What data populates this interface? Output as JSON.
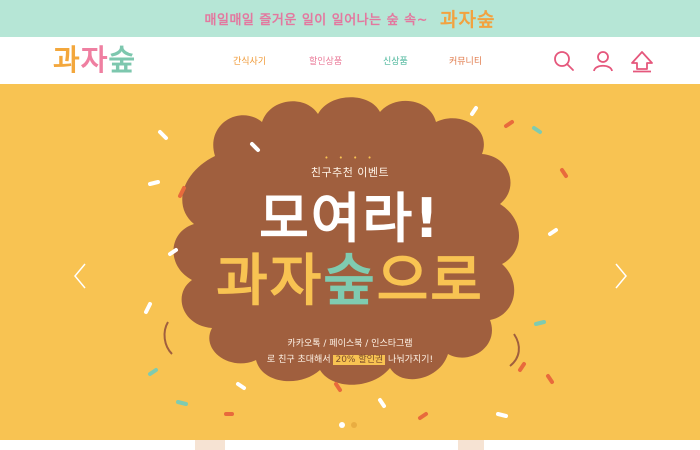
{
  "promo": {
    "text": "매일매일 즐거운 일이 일어나는 숲 속~",
    "logo": "과자숲"
  },
  "header": {
    "logo": {
      "part1": "과",
      "part2": "자",
      "part3": "숲"
    },
    "nav": [
      {
        "label": "간식사기"
      },
      {
        "label": "할인상품"
      },
      {
        "label": "신상품"
      },
      {
        "label": "커뮤니티"
      }
    ],
    "icons": [
      "search-icon",
      "user-icon",
      "home-icon"
    ]
  },
  "hero": {
    "eyebrow": "친구추천 이벤트",
    "headline1": "모여라!",
    "headline2_part1": "과자",
    "headline2_accent": "숲",
    "headline2_part2": "으로",
    "sub_line1": "카카오톡 / 페이스북 / 인스타그램",
    "sub_line2_pre": "로 친구 초대해서 ",
    "sub_line2_highlight": "20% 할인권",
    "sub_line2_post": " 나눠가지기!",
    "slides": {
      "count": 2,
      "active": 1
    }
  },
  "colors": {
    "promo_bg": "#b6e6d6",
    "hero_bg": "#f8c352",
    "blob": "#a05f3e",
    "accent_green": "#7fcbb0",
    "accent_pink": "#e3789f"
  }
}
